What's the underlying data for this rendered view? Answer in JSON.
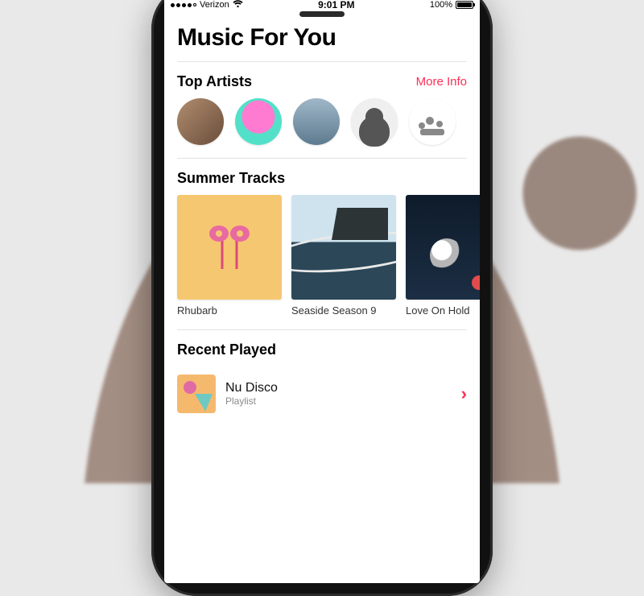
{
  "statusbar": {
    "carrier": "Verizon",
    "time": "9:01 PM",
    "battery_pct": "100%"
  },
  "header": {
    "title": "Music For You"
  },
  "top_artists": {
    "heading": "Top Artists",
    "more_label": "More Info",
    "items": [
      {
        "name": "artist-1"
      },
      {
        "name": "artist-2"
      },
      {
        "name": "artist-3"
      },
      {
        "name": "artist-4"
      },
      {
        "name": "artist-5"
      }
    ]
  },
  "summer_tracks": {
    "heading": "Summer Tracks",
    "items": [
      {
        "title": "Rhubarb"
      },
      {
        "title": "Seaside Season 9"
      },
      {
        "title": "Love On Hold"
      }
    ]
  },
  "recent_played": {
    "heading": "Recent Played",
    "item": {
      "title": "Nu Disco",
      "subtitle": "Playlist"
    }
  },
  "colors": {
    "accent": "#ff2d55"
  }
}
